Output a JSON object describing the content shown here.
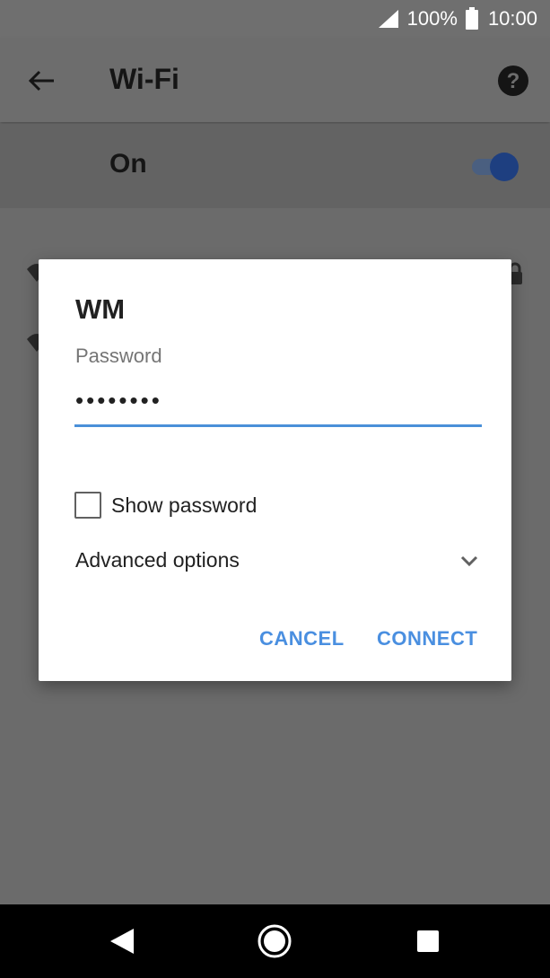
{
  "status_bar": {
    "battery_percent": "100%",
    "time": "10:00",
    "signal_icon": "signal-icon",
    "battery_icon": "battery-icon"
  },
  "app_bar": {
    "title": "Wi-Fi",
    "back_icon": "back-arrow-icon",
    "help_icon": "help-icon"
  },
  "wifi_toggle": {
    "label": "On",
    "state": true
  },
  "dialog": {
    "network_name": "WM",
    "password_label": "Password",
    "password_value": "••••••••",
    "show_password_label": "Show password",
    "show_password_checked": false,
    "advanced_options_label": "Advanced options",
    "cancel_label": "CANCEL",
    "connect_label": "CONNECT"
  },
  "colors": {
    "accent": "#4a8fe0",
    "toggle_thumb": "#1e3f80",
    "scrim": "#6b6b6b"
  },
  "nav_bar": {
    "back_icon": "nav-back-icon",
    "home_icon": "nav-home-icon",
    "recents_icon": "nav-recents-icon"
  }
}
